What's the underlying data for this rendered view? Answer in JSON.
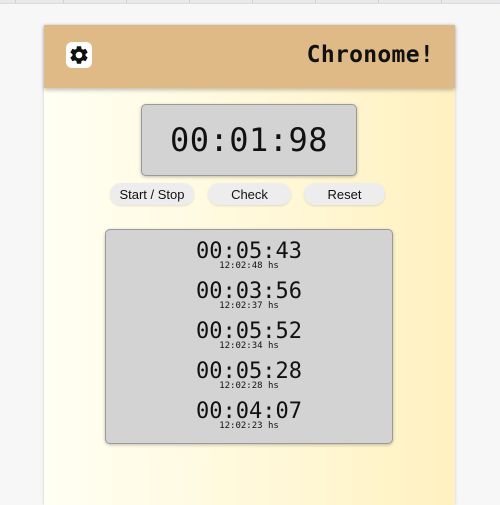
{
  "header": {
    "title": "Chronome!",
    "settings_icon": "gear-icon",
    "background_color": "#dfba87"
  },
  "stopwatch": {
    "time": "00:01:98"
  },
  "controls": {
    "start_stop_label": "Start / Stop",
    "check_label": "Check",
    "reset_label": "Reset"
  },
  "laps": [
    {
      "time": "00:05:43",
      "timestamp": "12:02:48 hs"
    },
    {
      "time": "00:03:56",
      "timestamp": "12:02:37 hs"
    },
    {
      "time": "00:05:52",
      "timestamp": "12:02:34 hs"
    },
    {
      "time": "00:05:28",
      "timestamp": "12:02:28 hs"
    },
    {
      "time": "00:04:07",
      "timestamp": "12:02:23 hs"
    }
  ]
}
